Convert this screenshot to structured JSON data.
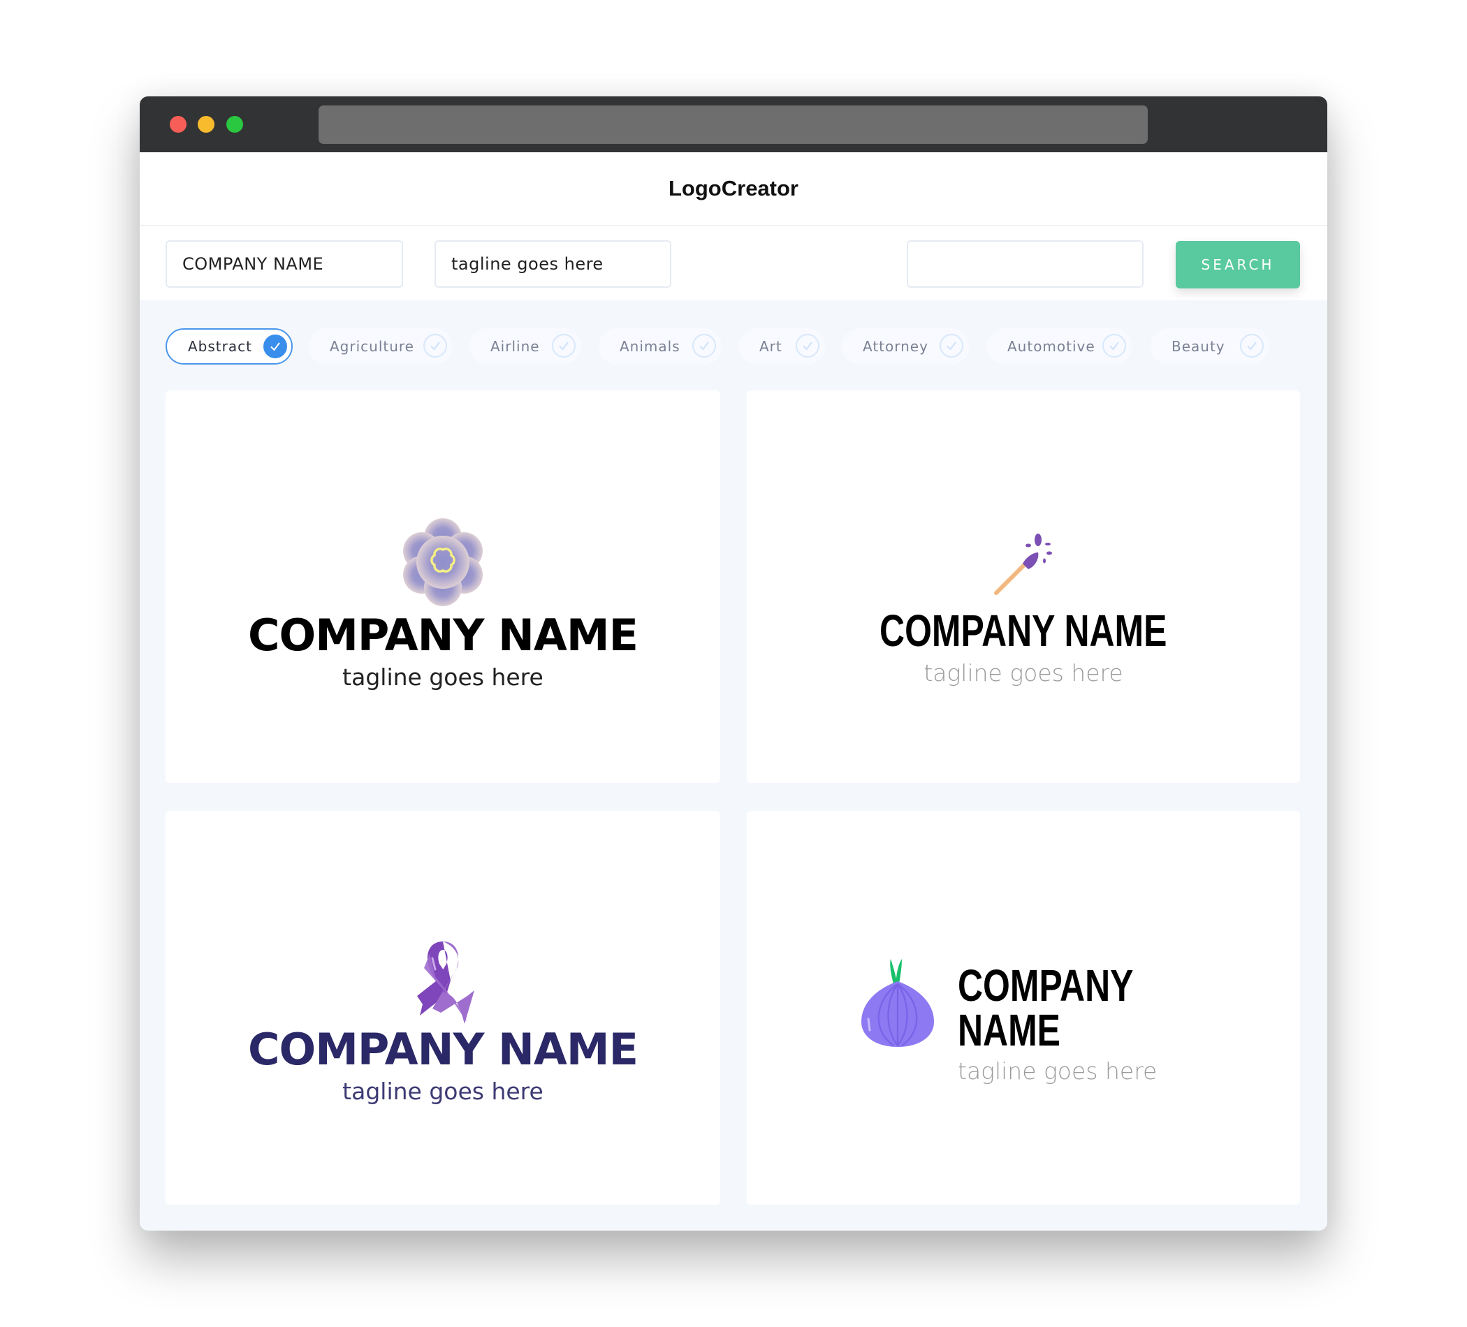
{
  "window": {
    "controls": [
      "close",
      "minimize",
      "maximize"
    ],
    "url": ""
  },
  "header": {
    "title": "LogoCreator"
  },
  "search_bar": {
    "company_name_value": "COMPANY NAME",
    "tagline_value": "tagline goes here",
    "keyword_value": "",
    "search_label": "SEARCH",
    "search_color": "#59c9a0"
  },
  "categories": {
    "items": [
      {
        "label": "Abstract",
        "selected": true
      },
      {
        "label": "Agriculture",
        "selected": false
      },
      {
        "label": "Airline",
        "selected": false
      },
      {
        "label": "Animals",
        "selected": false
      },
      {
        "label": "Art",
        "selected": false
      },
      {
        "label": "Attorney",
        "selected": false
      },
      {
        "label": "Automotive",
        "selected": false
      },
      {
        "label": "Beauty",
        "selected": false
      }
    ],
    "next_icon": "arrow-right-icon",
    "accent_color": "#3a8eeb"
  },
  "logos": [
    {
      "icon": "flower-icon",
      "company": "COMPANY NAME",
      "tagline": "tagline goes here",
      "text_color": "#000000",
      "tagline_color": "#222222"
    },
    {
      "icon": "paintbrush-icon",
      "company": "COMPANY NAME",
      "tagline": "tagline goes here",
      "text_color": "#000000",
      "tagline_color": "#9a9a9a"
    },
    {
      "icon": "awareness-ribbon-icon",
      "company": "COMPANY NAME",
      "tagline": "tagline goes here",
      "text_color": "#2a2866",
      "tagline_color": "#3d3b74"
    },
    {
      "icon": "onion-icon",
      "company": "COMPANY NAME",
      "tagline": "tagline goes here",
      "text_color": "#000000",
      "tagline_color": "#9a9a9a"
    }
  ]
}
